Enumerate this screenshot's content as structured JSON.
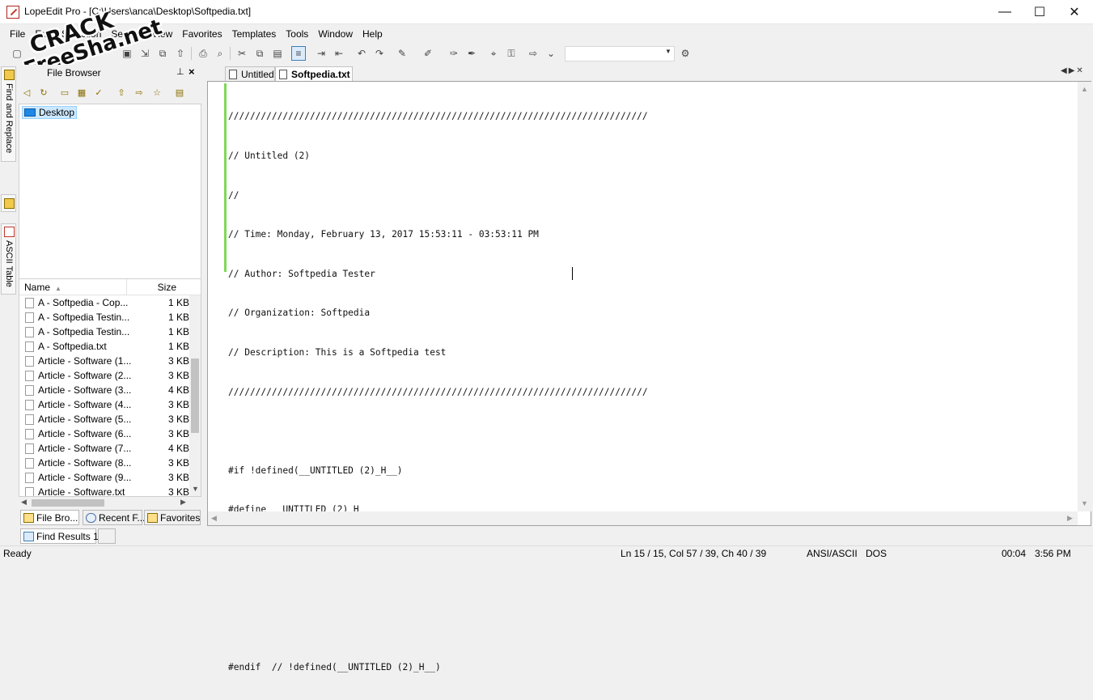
{
  "window": {
    "title": "LopeEdit Pro - [C:\\Users\\anca\\Desktop\\Softpedia.txt]",
    "controls": {
      "minimize": "—",
      "maximize": "☐",
      "close": "✕"
    }
  },
  "menu": [
    "File",
    "Edit",
    "Selection",
    "Search",
    "View",
    "Favorites",
    "Templates",
    "Tools",
    "Window",
    "Help"
  ],
  "watermark": {
    "line1": "CRACK",
    "line2": "FreeSha.net"
  },
  "left_strip": {
    "find_replace": "Find and Replace",
    "ascii_table": "ASCII Table"
  },
  "file_browser": {
    "title": "File Browser",
    "tree": {
      "root": "Desktop"
    },
    "columns": {
      "name": "Name",
      "size": "Size"
    },
    "files": [
      {
        "name": "A - Softpedia - Cop...",
        "size": "1 KB"
      },
      {
        "name": "A - Softpedia Testin...",
        "size": "1 KB"
      },
      {
        "name": "A - Softpedia Testin...",
        "size": "1 KB"
      },
      {
        "name": "A - Softpedia.txt",
        "size": "1 KB"
      },
      {
        "name": "Article - Software (1...",
        "size": "3 KB"
      },
      {
        "name": "Article - Software (2...",
        "size": "3 KB"
      },
      {
        "name": "Article - Software (3...",
        "size": "4 KB"
      },
      {
        "name": "Article - Software (4...",
        "size": "3 KB"
      },
      {
        "name": "Article - Software (5...",
        "size": "3 KB"
      },
      {
        "name": "Article - Software (6...",
        "size": "3 KB"
      },
      {
        "name": "Article - Software (7...",
        "size": "4 KB"
      },
      {
        "name": "Article - Software (8...",
        "size": "3 KB"
      },
      {
        "name": "Article - Software (9...",
        "size": "3 KB"
      },
      {
        "name": "Article - Software.txt",
        "size": "3 KB"
      }
    ],
    "tabs": {
      "file_browser": "File Bro...",
      "recent": "Recent F...",
      "favorites": "Favorites"
    }
  },
  "results_panel": {
    "tab": "Find Results 1"
  },
  "editor": {
    "tabs": [
      {
        "label": "Untitled"
      },
      {
        "label": "Softpedia.txt"
      }
    ],
    "lines": [
      "/////////////////////////////////////////////////////////////////////////////",
      "// Untitled (2)",
      "//",
      "// Time: Monday, February 13, 2017 15:53:11 - 03:53:11 PM",
      "// Author: Softpedia Tester",
      "// Organization: Softpedia",
      "// Description: This is a Softpedia test",
      "/////////////////////////////////////////////////////////////////////////////",
      "",
      "#if !defined(__UNTITLED (2)_H__)",
      "#define __UNTITLED (2)_H__",
      "",
      "",
      "",
      "#endif  // !defined(__UNTITLED (2)_H__)"
    ]
  },
  "status": {
    "ready": "Ready",
    "position": "Ln 15 / 15, Col 57 / 39, Ch 40 / 39",
    "encoding": "ANSI/ASCII",
    "line_ending": "DOS",
    "elapsed": "00:04",
    "clock": "3:56 PM"
  },
  "colors": {
    "accent": "#3c7fb1",
    "gutter": "#7ed957",
    "selection": "#cce8ff"
  }
}
